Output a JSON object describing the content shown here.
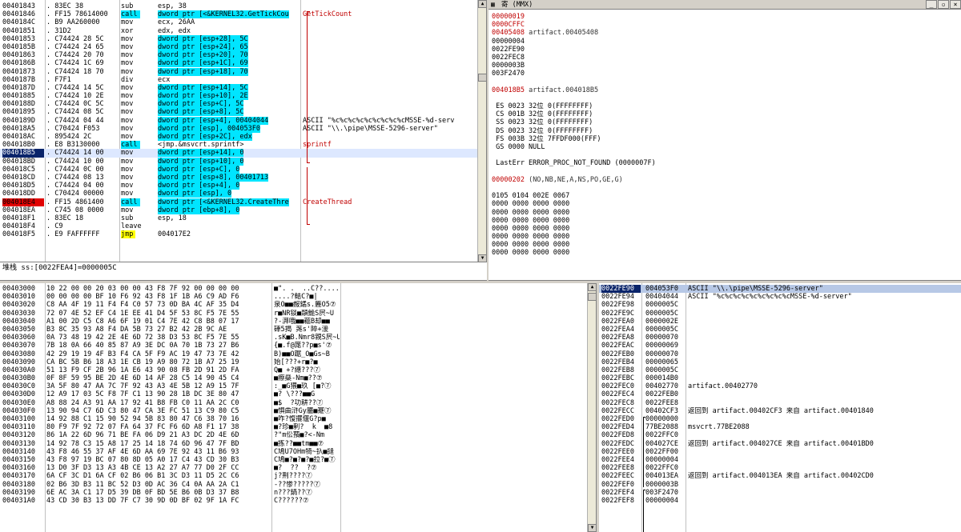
{
  "disasm": {
    "rows": [
      {
        "addr": "00401843",
        "hex": ". 83EC 38",
        "mn": "sub",
        "op": "esp, 38",
        "cm": "",
        "st": ""
      },
      {
        "addr": "00401846",
        "hex": ". FF15 78614000",
        "mn": "call",
        "op": "dword ptr [<&KERNEL32.GetTickCou",
        "cm": "GetTickCount",
        "st": "call"
      },
      {
        "addr": "0040184C",
        "hex": ". B9 AA260000",
        "mn": "mov",
        "op": "ecx, 26AA",
        "cm": "",
        "st": ""
      },
      {
        "addr": "00401851",
        "hex": ". 31D2",
        "mn": "xor",
        "op": "edx, edx",
        "cm": "",
        "st": ""
      },
      {
        "addr": "00401853",
        "hex": ". C74424 28 5C",
        "mn": "mov",
        "op": "dword ptr [esp+28], 5C",
        "cm": "",
        "st": "mem"
      },
      {
        "addr": "0040185B",
        "hex": ". C74424 24 65",
        "mn": "mov",
        "op": "dword ptr [esp+24], 65",
        "cm": "",
        "st": "mem"
      },
      {
        "addr": "00401863",
        "hex": ". C74424 20 70",
        "mn": "mov",
        "op": "dword ptr [esp+20], 70",
        "cm": "",
        "st": "mem"
      },
      {
        "addr": "0040186B",
        "hex": ". C74424 1C 69",
        "mn": "mov",
        "op": "dword ptr [esp+1C], 69",
        "cm": "",
        "st": "mem"
      },
      {
        "addr": "00401873",
        "hex": ". C74424 18 70",
        "mn": "mov",
        "op": "dword ptr [esp+18], 70",
        "cm": "",
        "st": "mem"
      },
      {
        "addr": "0040187B",
        "hex": ". F7F1",
        "mn": "div",
        "op": "ecx",
        "cm": "",
        "st": ""
      },
      {
        "addr": "0040187D",
        "hex": ". C74424 14 5C",
        "mn": "mov",
        "op": "dword ptr [esp+14], 5C",
        "cm": "",
        "st": "mem"
      },
      {
        "addr": "00401885",
        "hex": ". C74424 10 2E",
        "mn": "mov",
        "op": "dword ptr [esp+10], 2E",
        "cm": "",
        "st": "mem"
      },
      {
        "addr": "0040188D",
        "hex": ". C74424 0C 5C",
        "mn": "mov",
        "op": "dword ptr [esp+C], 5C",
        "cm": "",
        "st": "mem"
      },
      {
        "addr": "00401895",
        "hex": ". C74424 08 5C",
        "mn": "mov",
        "op": "dword ptr [esp+8], 5C",
        "cm": "",
        "st": "mem"
      },
      {
        "addr": "0040189D",
        "hex": ". C74424 04 44",
        "mn": "mov",
        "op": "dword ptr [esp+4], 00404044",
        "cm": "ASCII \"%c%c%c%c%c%c%c%c%cMSSE-%d-serv",
        "st": "mem"
      },
      {
        "addr": "004018A5",
        "hex": ". C70424 F053",
        "mn": "mov",
        "op": "dword ptr [esp], 004053F0",
        "cm": "ASCII \"\\\\.\\pipe\\MSSE-5296-server\"",
        "st": "mem"
      },
      {
        "addr": "004018AC",
        "hex": ". 895424 2C",
        "mn": "mov",
        "op": "dword ptr [esp+2C], edx",
        "cm": "",
        "st": "mem"
      },
      {
        "addr": "004018B0",
        "hex": ". E8 B3130000",
        "mn": "call",
        "op": "<jmp.&msvcrt.sprintf>",
        "cm": "sprintf",
        "st": "call2"
      },
      {
        "addr": "004018B5",
        "hex": ". C74424 14 00",
        "mn": "mov",
        "op": "dword ptr [esp+14], 0",
        "cm": "",
        "st": "selrow"
      },
      {
        "addr": "004018BD",
        "hex": ". C74424 10 00",
        "mn": "mov",
        "op": "dword ptr [esp+10], 0",
        "cm": "",
        "st": "mem"
      },
      {
        "addr": "004018C5",
        "hex": ". C74424 0C 00",
        "mn": "mov",
        "op": "dword ptr [esp+C], 0",
        "cm": "",
        "st": "mem"
      },
      {
        "addr": "004018CD",
        "hex": ". C74424 08 13",
        "mn": "mov",
        "op": "dword ptr [esp+8], 00401713",
        "cm": "",
        "st": "mem"
      },
      {
        "addr": "004018D5",
        "hex": ". C74424 04 00",
        "mn": "mov",
        "op": "dword ptr [esp+4], 0",
        "cm": "",
        "st": "mem"
      },
      {
        "addr": "004018DD",
        "hex": ". C70424 00000",
        "mn": "mov",
        "op": "dword ptr [esp], 0",
        "cm": "",
        "st": "mem"
      },
      {
        "addr": "004018E4",
        "hex": ". FF15 4861400",
        "mn": "call",
        "op": "dword ptr [<&KERNEL32.CreateThre",
        "cm": "CreateThread",
        "st": "bp"
      },
      {
        "addr": "004018EA",
        "hex": ". C745 08 0000",
        "mn": "mov",
        "op": "dword ptr [ebp+8], 0",
        "cm": "",
        "st": "mem"
      },
      {
        "addr": "004018F1",
        "hex": ". 83EC 18",
        "mn": "sub",
        "op": "esp, 18",
        "cm": "",
        "st": ""
      },
      {
        "addr": "004018F4",
        "hex": ". C9",
        "mn": "leave",
        "op": "",
        "cm": "",
        "st": ""
      },
      {
        "addr": "004018F5",
        "hex": ". E9 FAFFFFFF",
        "mn": "jmp",
        "op": "004017E2",
        "cm": "",
        "st": "jmp"
      }
    ],
    "status": "堆栈 ss:[0022FEA4]=0000005C"
  },
  "registers": {
    "title": "寄 (MMX)",
    "lines": [
      {
        "t": "00000019",
        "c": "red"
      },
      {
        "t": "0000CFFC",
        "c": "red"
      },
      {
        "t": "00405408 artifact.00405408",
        "c": "redhead"
      },
      {
        "t": "00000004",
        "c": ""
      },
      {
        "t": "0022FE90",
        "c": ""
      },
      {
        "t": "0022FEC8",
        "c": ""
      },
      {
        "t": "0000003B",
        "c": ""
      },
      {
        "t": "003F2470",
        "c": ""
      },
      {
        "t": "",
        "c": ""
      },
      {
        "t": "004018B5 artifact.004018B5",
        "c": "redhead"
      },
      {
        "t": "",
        "c": ""
      },
      {
        "t": " ES 0023 32位 0(FFFFFFFF)",
        "c": ""
      },
      {
        "t": " CS 001B 32位 0(FFFFFFFF)",
        "c": ""
      },
      {
        "t": " SS 0023 32位 0(FFFFFFFF)",
        "c": ""
      },
      {
        "t": " DS 0023 32位 0(FFFFFFFF)",
        "c": ""
      },
      {
        "t": " FS 003B 32位 7FFDF000(FFF)",
        "c": ""
      },
      {
        "t": " GS 0000 NULL",
        "c": ""
      },
      {
        "t": "",
        "c": ""
      },
      {
        "t": " LastErr ERROR_PROC_NOT_FOUND (0000007F)",
        "c": ""
      },
      {
        "t": "",
        "c": ""
      },
      {
        "t": "00000202 (NO,NB,NE,A,NS,PO,GE,G)",
        "c": "redhead"
      },
      {
        "t": "",
        "c": ""
      },
      {
        "t": "0105 0104 002E 0067",
        "c": ""
      },
      {
        "t": "0000 0000 0000 0000",
        "c": ""
      },
      {
        "t": "0000 0000 0000 0000",
        "c": ""
      },
      {
        "t": "0000 0000 0000 0000",
        "c": ""
      },
      {
        "t": "0000 0000 0000 0000",
        "c": ""
      },
      {
        "t": "0000 0000 0000 0000",
        "c": ""
      },
      {
        "t": "0000 0000 0000 0000",
        "c": ""
      },
      {
        "t": "0000 0000 0000 0000",
        "c": ""
      }
    ]
  },
  "dump": {
    "rows": [
      {
        "a": "00403000",
        "h": "10 22 00 00 20 03 00 00 43 F8 7F 92 00 00 00 00",
        "s": "■\". .  ..C??...."
      },
      {
        "a": "00403010",
        "h": "00 00 00 00 BF 10 F6 92 43 F8 1F 1B A6 C9 AD F6",
        "s": "....?鲒C?■|"
      },
      {
        "a": "00403020",
        "h": "C8 AA 4F 19 11 F4 F4 C0 57 73 0D BA 4C AF 35 D4",
        "s": "泉O■■赧鐍s.簏O5⑦"
      },
      {
        "a": "00403030",
        "h": "72 07 4E 52 EF C4 1E EE 41 D4 5F 53 8C F5 7E 55",
        "s": "r■NR锬■頮鮠S屄~U"
      },
      {
        "a": "00403040",
        "h": "A1 00 2D C5 C8 A6 6F 19 01 C4 7E 42 C8 B8 07 17",
        "s": "?-湃哦■■藲B却■■"
      },
      {
        "a": "00403050",
        "h": "B3 8C 35 93 A8 F4 DA 5B 73 27 B2 42 2B 9C AE",
        "s": "硨5揭 荛s'睟+湲"
      },
      {
        "a": "00403060",
        "h": "0A 73 48 19 42 2E 4E 6D 72 38 D3 53 8C F5 7E 55",
        "s": ".sK■B.Nmr8親S屄~U"
      },
      {
        "a": "00403070",
        "h": "7B 18 0A 66 40 85 87 A9 3E DC 0A 70 1B 73 27 B6",
        "s": "{■.f@厖??p■s'⑦"
      },
      {
        "a": "00403080",
        "h": "42 29 19 19 4F B3 F4 CA 5F F9 AC 19 47 73 7E 42",
        "s": "B)■■O踞_O■Gs~B"
      },
      {
        "a": "00403090",
        "h": "CA BC 5B B6 18 A3 1E CB 19 A9 80 72 1B A7 25 19",
        "s": "始[???+r■?■"
      },
      {
        "a": "004030A0",
        "h": "51 13 F9 CF 2B 96 1A E6 43 90 08 FB 2D 91 2D FA",
        "s": "Q■ +?繐???⑦"
      },
      {
        "a": "004030B0",
        "h": "0F 8F 59 95 BE 2D 4E 6D 14 AF 28 C5 14 90 45 C4",
        "s": "■瘵燊-Nm■??⑦"
      },
      {
        "a": "004030C0",
        "h": "3A 5F 80 47 AA 7C 7F 92 43 A3 4E 5B 12 A9 15 7F",
        "s": ":_■G猥■玖 [■?⑦"
      },
      {
        "a": "004030D0",
        "h": "12 A9 17 03 5C F8 7F C1 13 90 28 1B DC 3E 80 47",
        "s": "■? \\???■■G"
      },
      {
        "a": "004030E0",
        "h": "A8 88 24 A3 91 AA 17 92 41 B8 FB C0 11 AA 2C C0",
        "s": "■$  ?功耕??⑦"
      },
      {
        "a": "004030F0",
        "h": "13 90 94 C7 6D C3 80 47 CA 3E FC 51 13 C9 80 C5",
        "s": "■惧曲浒Gy靥■蹇⑦"
      },
      {
        "a": "00403100",
        "h": "14 92 88 C1 15 90 52 94 5B 83 80 47 C6 38 70 16",
        "s": "■咋?愎擺偃G?p■"
      },
      {
        "a": "00403110",
        "h": "80 F9 7F 92 72 07 FA 64 37 FC F6 6D A8 F1 17 38",
        "s": "■?珍■剢?  k  ■8"
      },
      {
        "a": "00403120",
        "h": "86 1A 22 6D 96 71 BE FA 06 D9 21 A3 DC 2D 4E 6D",
        "s": "?\"m伀蕷■?<-Nm"
      },
      {
        "a": "00403130",
        "h": "14 92 78 C3 15 A8 17 25 14 18 74 6D 96 47 7F BD",
        "s": "■拣??■■tm■■⑦"
      },
      {
        "a": "00403140",
        "h": "43 F8 46 55 37 AF 4E 6D AA 69 7E 92 43 11 B6 93",
        "s": "C鳩U7OHm犄~扖■摓"
      },
      {
        "a": "00403150",
        "h": "43 F8 97 19 BC 07 80 8D 05 A0 17 C4 43 CD 30 B3",
        "s": "C鳩■?■?■?■拉?■⑦"
      },
      {
        "a": "00403160",
        "h": "13 D0 3F D3 13 A3 4B CE 13 A2 27 A7 77 D0 2F CC",
        "s": "■?  ??  ?⑦"
      },
      {
        "a": "00403170",
        "h": "6A CF 3C D1 6A CF 02 B6 06 B1 3C D3 11 D5 2C C6",
        "s": "j?荆????⑦"
      },
      {
        "a": "00403180",
        "h": "02 B6 3D B3 11 BC 52 D3 0D AC 36 C4 0A AA 2A C1",
        "s": "-??惨?????⑦"
      },
      {
        "a": "00403190",
        "h": "6E AC 3A C1 17 D5 39 DB 0F BD 5E B6 0B D3 37 B8",
        "s": "n???鍋??⑦"
      },
      {
        "a": "004031A0",
        "h": "43 CD 30 B3 13 DD 7F C7 30 9D 0D BF 02 9F 1A FC",
        "s": "C??????⑦"
      }
    ]
  },
  "stack": {
    "rows": [
      {
        "a": "0022FE90",
        "v": "004053F0",
        "c": "ASCII \"\\\\.\\pipe\\MSSE-5296-server\"",
        "st": "sel"
      },
      {
        "a": "0022FE94",
        "v": "00404044",
        "c": "ASCII \"%c%c%c%c%c%c%c%c%cMSSE-%d-server\"",
        "st": ""
      },
      {
        "a": "0022FE98",
        "v": "0000005C",
        "c": "",
        "st": ""
      },
      {
        "a": "0022FE9C",
        "v": "0000005C",
        "c": "",
        "st": ""
      },
      {
        "a": "0022FEA0",
        "v": "0000002E",
        "c": "",
        "st": ""
      },
      {
        "a": "0022FEA4",
        "v": "0000005C",
        "c": "",
        "st": ""
      },
      {
        "a": "0022FEA8",
        "v": "00000070",
        "c": "",
        "st": ""
      },
      {
        "a": "0022FEAC",
        "v": "00000069",
        "c": "",
        "st": ""
      },
      {
        "a": "0022FEB0",
        "v": "00000070",
        "c": "",
        "st": ""
      },
      {
        "a": "0022FEB4",
        "v": "00000065",
        "c": "",
        "st": ""
      },
      {
        "a": "0022FEB8",
        "v": "0000005C",
        "c": "",
        "st": ""
      },
      {
        "a": "0022FEBC",
        "v": "000014B0",
        "c": "",
        "st": ""
      },
      {
        "a": "0022FEC0",
        "v": "00402770",
        "c": "artifact.00402770",
        "st": ""
      },
      {
        "a": "0022FEC4",
        "v": "0022FEB0",
        "c": "",
        "st": ""
      },
      {
        "a": "0022FEC8",
        "v": "0022FEE8",
        "c": "",
        "st": "frame"
      },
      {
        "a": "0022FECC",
        "v": "00402CF3",
        "c": "返回到 artifact.00402CF3 来自 artifact.00401840",
        "st": "frame"
      },
      {
        "a": "0022FED0",
        "v": "00000000",
        "c": "",
        "st": "frame"
      },
      {
        "a": "0022FED4",
        "v": "77BE2088",
        "c": "msvcrt.77BE2088",
        "st": "frame"
      },
      {
        "a": "0022FED8",
        "v": "0022FFC0",
        "c": "",
        "st": "frame"
      },
      {
        "a": "0022FEDC",
        "v": "004027CE",
        "c": "返回到 artifact.004027CE 来自 artifact.00401BD0",
        "st": "frame"
      },
      {
        "a": "0022FEE0",
        "v": "0022FF00",
        "c": "",
        "st": "frame"
      },
      {
        "a": "0022FEE4",
        "v": "00000004",
        "c": "",
        "st": "frame"
      },
      {
        "a": "0022FEE8",
        "v": "0022FFC0",
        "c": "",
        "st": "frame2"
      },
      {
        "a": "0022FEEC",
        "v": "004013EA",
        "c": "返回到 artifact.004013EA 来自 artifact.00402CD0",
        "st": "frame2"
      },
      {
        "a": "0022FEF0",
        "v": "0000003B",
        "c": "",
        "st": "frame2"
      },
      {
        "a": "0022FEF4",
        "v": "003F2470",
        "c": "",
        "st": "frame2"
      },
      {
        "a": "0022FEF8",
        "v": "00000004",
        "c": "",
        "st": "frame2"
      }
    ]
  }
}
